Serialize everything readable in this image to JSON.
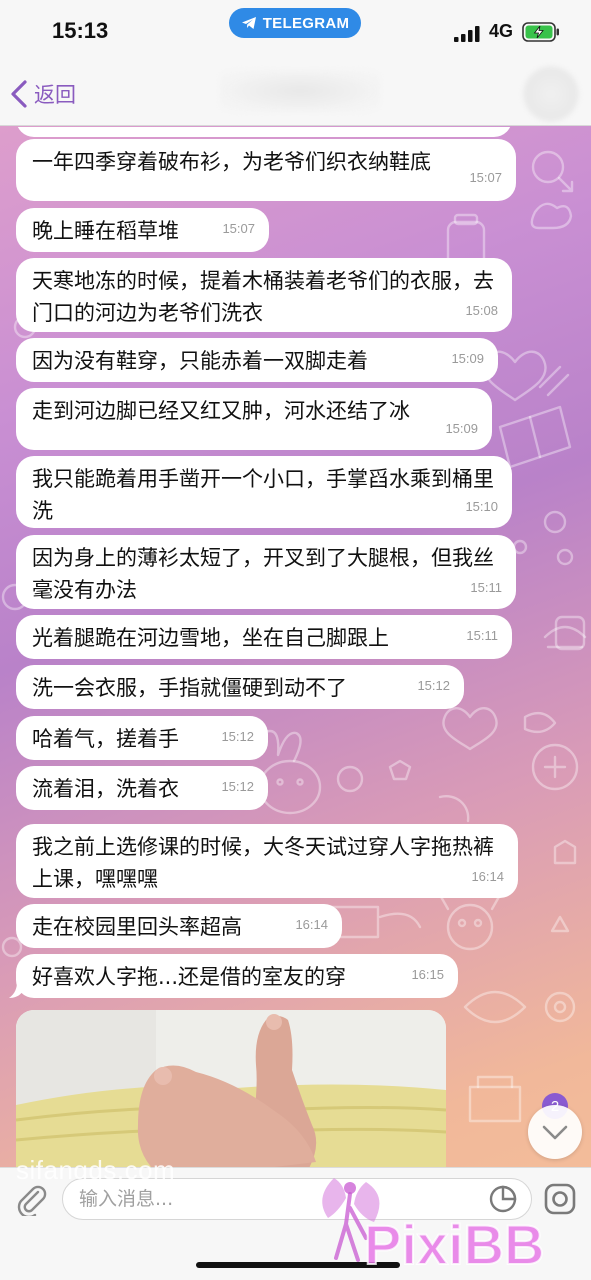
{
  "status_bar": {
    "time": "15:13",
    "app_pill": "TELEGRAM",
    "network": "4G"
  },
  "nav": {
    "back_label": "返回"
  },
  "messages": [
    {
      "text": "一年四季穿着破布衫，为老爷们织衣纳鞋底",
      "time": "15:07"
    },
    {
      "text": "晚上睡在稻草堆",
      "time": "15:07"
    },
    {
      "text": "天寒地冻的时候，提着木桶装着老爷们的衣服，去门口的河边为老爷们洗衣",
      "time": "15:08"
    },
    {
      "text": "因为没有鞋穿，只能赤着一双脚走着",
      "time": "15:09"
    },
    {
      "text": "走到河边脚已经又红又肿，河水还结了冰",
      "time": "15:09"
    },
    {
      "text": "我只能跪着用手凿开一个小口，手掌舀水乘到桶里洗",
      "time": "15:10"
    },
    {
      "text": "因为身上的薄衫太短了，开叉到了大腿根，但我丝毫没有办法",
      "time": "15:11"
    },
    {
      "text": "光着腿跪在河边雪地，坐在自己脚跟上",
      "time": "15:11"
    },
    {
      "text": "洗一会衣服，手指就僵硬到动不了",
      "time": "15:12"
    },
    {
      "text": "哈着气，搓着手",
      "time": "15:12"
    },
    {
      "text": "流着泪，洗着衣",
      "time": "15:12"
    },
    {
      "text": "我之前上选修课的时候，大冬天试过穿人字拖热裤上课，嘿嘿嘿",
      "time": "16:14"
    },
    {
      "text": "走在校园里回头率超高",
      "time": "16:14"
    },
    {
      "text": "好喜欢人字拖...还是借的室友的穿",
      "time": "16:15"
    }
  ],
  "unread_count": "2",
  "input": {
    "placeholder": "输入消息..."
  },
  "watermarks": {
    "site": "sifangds.com",
    "logo": "PixiBB"
  },
  "colors": {
    "accent": "#8a5bbf",
    "telegram_blue": "#2f8ae6",
    "badge": "#8a5bd1",
    "bubble": "#ffffff"
  }
}
